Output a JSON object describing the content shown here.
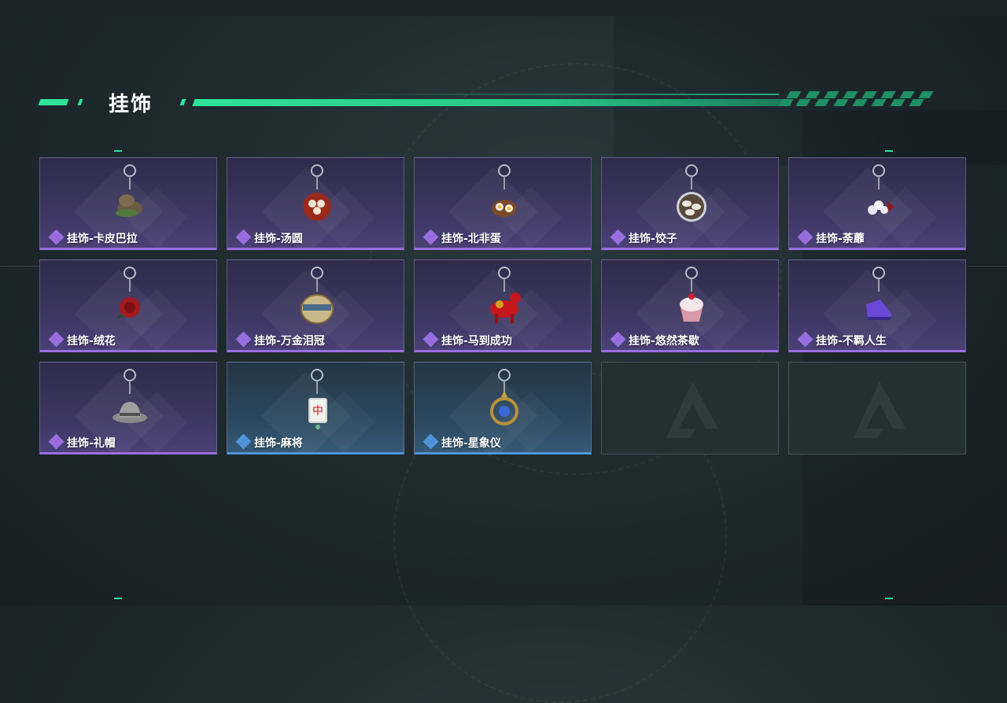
{
  "section": {
    "title": "挂饰"
  },
  "accent_color": "#2fe39a",
  "rarity_colors": {
    "epic": "#9a6ee0",
    "rare": "#4f94d8"
  },
  "items": [
    {
      "name": "挂饰-卡皮巴拉",
      "rarity": "epic",
      "icon": "capybara-charm-icon"
    },
    {
      "name": "挂饰-汤圆",
      "rarity": "epic",
      "icon": "tangyuan-charm-icon"
    },
    {
      "name": "挂饰-北非蛋",
      "rarity": "epic",
      "icon": "shakshuka-charm-icon"
    },
    {
      "name": "挂饰-饺子",
      "rarity": "epic",
      "icon": "dumplings-charm-icon"
    },
    {
      "name": "挂饰-荼蘼",
      "rarity": "epic",
      "icon": "white-flower-charm-icon"
    },
    {
      "name": "挂饰-绒花",
      "rarity": "epic",
      "icon": "red-rose-charm-icon"
    },
    {
      "name": "挂饰-万金泪冠",
      "rarity": "epic",
      "icon": "crown-charm-icon"
    },
    {
      "name": "挂饰-马到成功",
      "rarity": "epic",
      "icon": "red-horse-charm-icon"
    },
    {
      "name": "挂饰-悠然茶歇",
      "rarity": "epic",
      "icon": "cupcake-charm-icon"
    },
    {
      "name": "挂饰-不羁人生",
      "rarity": "epic",
      "icon": "sneaker-charm-icon"
    },
    {
      "name": "挂饰-礼帽",
      "rarity": "epic",
      "icon": "hat-charm-icon"
    },
    {
      "name": "挂饰-麻将",
      "rarity": "rare",
      "icon": "mahjong-tile-charm-icon"
    },
    {
      "name": "挂饰-星象仪",
      "rarity": "rare",
      "icon": "astrolabe-charm-icon"
    }
  ],
  "empty_slots": 2
}
